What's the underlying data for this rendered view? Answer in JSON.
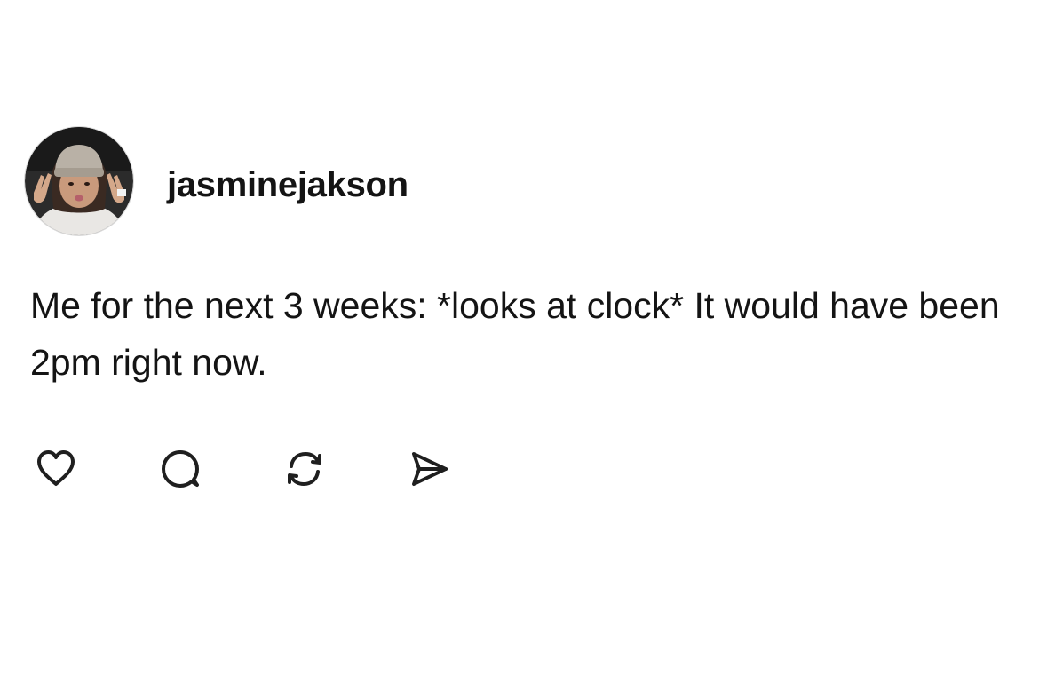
{
  "post": {
    "username": "jasminejakson",
    "text": "Me for the next 3 weeks: *looks at clock* It would have been 2pm right now.",
    "avatar_icon": "profile-photo",
    "actions": [
      {
        "id": "like",
        "icon": "heart-icon"
      },
      {
        "id": "reply",
        "icon": "speech-bubble-icon"
      },
      {
        "id": "repost",
        "icon": "repost-arrows-icon"
      },
      {
        "id": "share",
        "icon": "paper-plane-icon"
      }
    ]
  },
  "colors": {
    "text": "#141414",
    "icon_stroke": "#1f1f1f",
    "background": "#ffffff"
  }
}
